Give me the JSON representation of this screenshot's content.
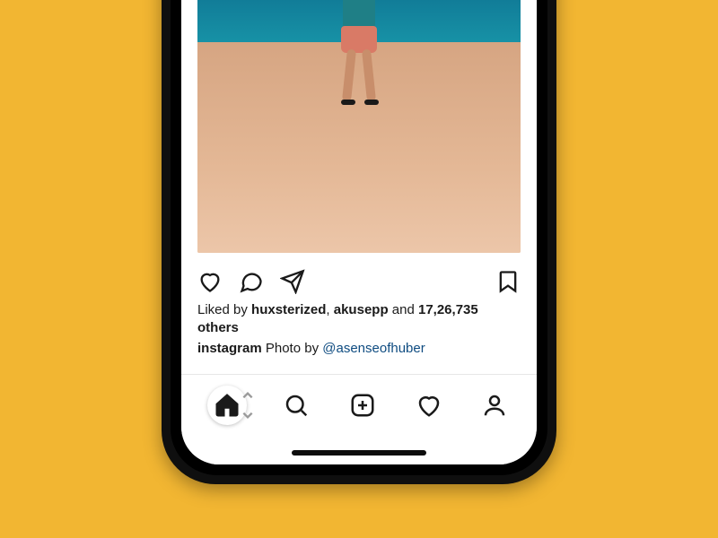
{
  "post": {
    "image_alt": "Person standing on a beach with arms spread, facing the ocean",
    "actions": {
      "like_icon": "heart-icon",
      "comment_icon": "speech-bubble-icon",
      "share_icon": "paper-plane-icon",
      "save_icon": "bookmark-icon"
    },
    "likes": {
      "prefix": "Liked by ",
      "user1": "huxsterized",
      "sep1": ", ",
      "user2": "akusepp",
      "sep2": " and ",
      "count": "17,26,735",
      "suffix": " others"
    },
    "caption": {
      "author": "instagram",
      "text_before_mention": " Photo by ",
      "mention": "@asenseofhuber"
    }
  },
  "tabbar": {
    "home": "home-icon",
    "search": "search-icon",
    "create": "plus-square-icon",
    "activity": "heart-icon",
    "profile": "person-icon"
  }
}
